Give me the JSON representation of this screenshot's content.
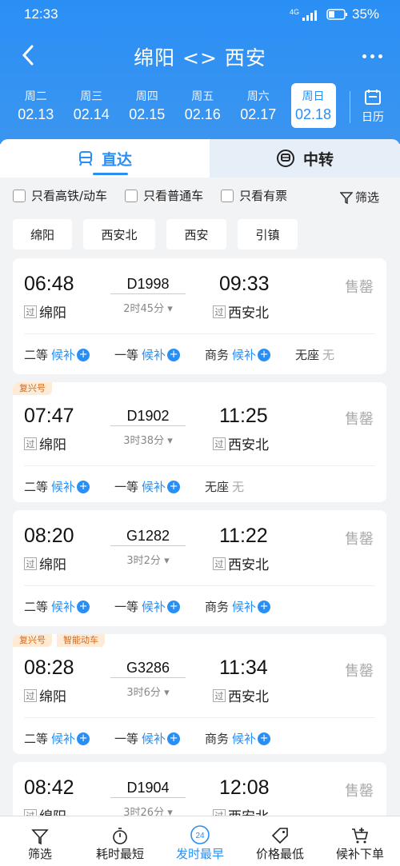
{
  "status_bar": {
    "time": "12:33",
    "battery": "35%",
    "signal": "4G"
  },
  "header": {
    "title": "绵阳 <> 西安"
  },
  "dates": [
    {
      "week": "周二",
      "date": "02.13"
    },
    {
      "week": "周三",
      "date": "02.14"
    },
    {
      "week": "周四",
      "date": "02.15"
    },
    {
      "week": "周五",
      "date": "02.16"
    },
    {
      "week": "周六",
      "date": "02.17"
    },
    {
      "week": "周日",
      "date": "02.18",
      "selected": true
    }
  ],
  "calendar_label": "日历",
  "tabs": {
    "direct": "直达",
    "transfer": "中转"
  },
  "filters": {
    "high_speed": "只看高铁/动车",
    "normal": "只看普通车",
    "available": "只看有票",
    "filter_btn": "筛选"
  },
  "stations": [
    "绵阳",
    "西安北",
    "西安",
    "引镇"
  ],
  "pass_mark": "过",
  "trains": [
    {
      "dep": "06:48",
      "arr": "09:33",
      "no": "D1998",
      "dur": "2时45分",
      "from": "绵阳",
      "to": "西安北",
      "status": "售罄",
      "tags": [],
      "seats": [
        {
          "name": "二等",
          "state": "候补"
        },
        {
          "name": "一等",
          "state": "候补"
        },
        {
          "name": "商务",
          "state": "候补"
        },
        {
          "name": "无座",
          "state": "无"
        }
      ]
    },
    {
      "dep": "07:47",
      "arr": "11:25",
      "no": "D1902",
      "dur": "3时38分",
      "from": "绵阳",
      "to": "西安北",
      "status": "售罄",
      "tags": [
        "复兴号"
      ],
      "seats": [
        {
          "name": "二等",
          "state": "候补"
        },
        {
          "name": "一等",
          "state": "候补"
        },
        {
          "name": "无座",
          "state": "无"
        }
      ]
    },
    {
      "dep": "08:20",
      "arr": "11:22",
      "no": "G1282",
      "dur": "3时2分",
      "from": "绵阳",
      "to": "西安北",
      "status": "售罄",
      "tags": [],
      "seats": [
        {
          "name": "二等",
          "state": "候补"
        },
        {
          "name": "一等",
          "state": "候补"
        },
        {
          "name": "商务",
          "state": "候补"
        }
      ]
    },
    {
      "dep": "08:28",
      "arr": "11:34",
      "no": "G3286",
      "dur": "3时6分",
      "from": "绵阳",
      "to": "西安北",
      "status": "售罄",
      "tags": [
        "复兴号",
        "智能动车"
      ],
      "seats": [
        {
          "name": "二等",
          "state": "候补"
        },
        {
          "name": "一等",
          "state": "候补"
        },
        {
          "name": "商务",
          "state": "候补"
        }
      ]
    },
    {
      "dep": "08:42",
      "arr": "12:08",
      "no": "D1904",
      "dur": "3时26分",
      "from": "绵阳",
      "to": "西安北",
      "status": "售罄",
      "tags": [],
      "seats": []
    }
  ],
  "bottom_nav": [
    "筛选",
    "耗时最短",
    "发时最早",
    "价格最低",
    "候补下单"
  ],
  "bottom_nav_badge": "24",
  "colors": {
    "primary": "#2a8ff5",
    "tag_bg": "#fdebd6",
    "tag_text": "#d2691e"
  }
}
